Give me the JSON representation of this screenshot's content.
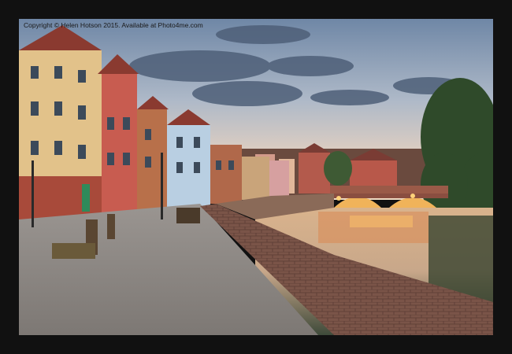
{
  "image": {
    "copyright_text": "Copyright © Helen Hotson 2015. Available at Photo4me.com",
    "frame_color": "#111111",
    "mat_color": "#ffffff"
  }
}
